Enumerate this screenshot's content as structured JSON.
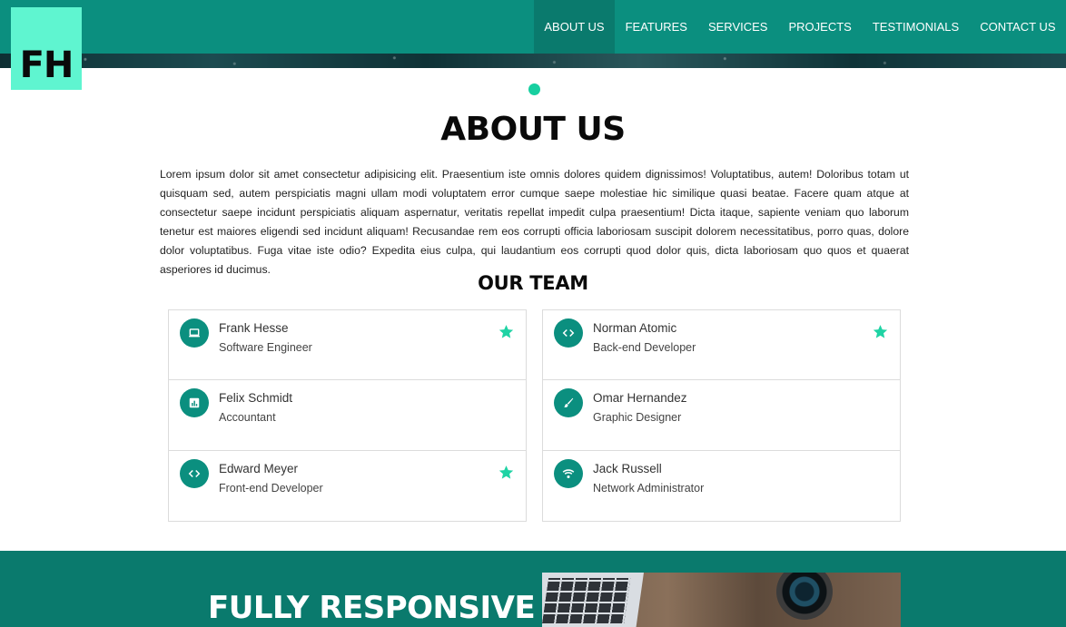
{
  "header": {
    "logo_text": "FH",
    "nav": [
      {
        "label": "ABOUT US",
        "active": true
      },
      {
        "label": "FEATURES",
        "active": false
      },
      {
        "label": "SERVICES",
        "active": false
      },
      {
        "label": "PROJECTS",
        "active": false
      },
      {
        "label": "TESTIMONIALS",
        "active": false
      },
      {
        "label": "CONTACT US",
        "active": false
      }
    ]
  },
  "about": {
    "title": "ABOUT US",
    "text": "Lorem ipsum dolor sit amet consectetur adipisicing elit. Praesentium iste omnis dolores quidem dignissimos! Voluptatibus, autem! Doloribus totam ut quisquam sed, autem perspiciatis magni ullam modi voluptatem error cumque saepe molestiae hic similique quasi beatae. Facere quam atque at consectetur saepe incidunt perspiciatis aliquam aspernatur, veritatis repellat impedit culpa praesentium! Dicta itaque, sapiente veniam quo laborum tenetur est maiores eligendi sed incidunt aliquam! Recusandae rem eos corrupti officia laboriosam suscipit dolorem necessitatibus, porro quas, dolore dolor voluptatibus. Fuga vitae iste odio? Expedita eius culpa, qui laudantium eos corrupti quod dolor quis, dicta laboriosam quo quos et quaerat asperiores id ducimus."
  },
  "team": {
    "title": "OUR TEAM",
    "left": [
      {
        "name": "Frank Hesse",
        "role": "Software Engineer",
        "icon": "laptop-icon",
        "starred": true
      },
      {
        "name": "Felix Schmidt",
        "role": "Accountant",
        "icon": "chart-icon",
        "starred": false
      },
      {
        "name": "Edward Meyer",
        "role": "Front-end Developer",
        "icon": "code-icon",
        "starred": true
      }
    ],
    "right": [
      {
        "name": "Norman Atomic",
        "role": "Back-end Developer",
        "icon": "code-icon",
        "starred": true
      },
      {
        "name": "Omar Hernandez",
        "role": "Graphic Designer",
        "icon": "brush-icon",
        "starred": false
      },
      {
        "name": "Jack Russell",
        "role": "Network Administrator",
        "icon": "wifi-icon",
        "starred": false
      }
    ]
  },
  "responsive": {
    "title": "FULLY RESPONSIVE"
  },
  "colors": {
    "primary": "#0b8f7f",
    "primary_dark": "#0a7a6d",
    "accent": "#17cfa0",
    "logo_bg": "#5ff5d0"
  }
}
